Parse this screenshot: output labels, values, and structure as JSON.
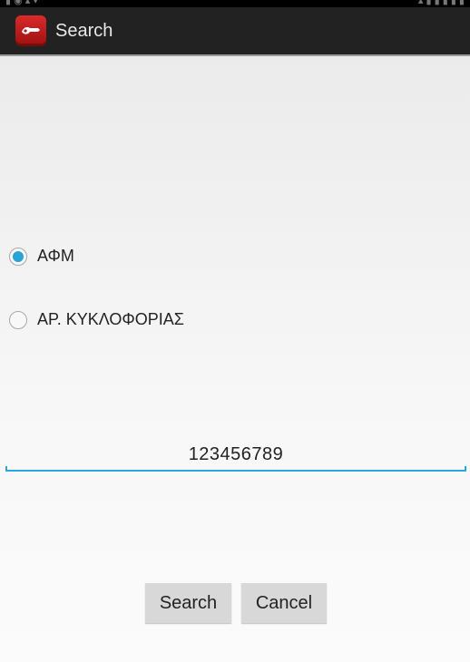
{
  "action_bar": {
    "title": "Search",
    "icon": "car-key-icon",
    "icon_color": "#c21d1d",
    "background": "#222222"
  },
  "search_type": {
    "options": [
      {
        "label": "ΑΦΜ",
        "selected": true
      },
      {
        "label": "ΑΡ. ΚΥΚΛΟΦΟΡΙΑΣ",
        "selected": false
      }
    ],
    "accent_color": "#2aa3d8"
  },
  "query_field": {
    "value": "123456789",
    "underline_color": "#2ea6da"
  },
  "buttons": {
    "search_label": "Search",
    "cancel_label": "Cancel"
  }
}
